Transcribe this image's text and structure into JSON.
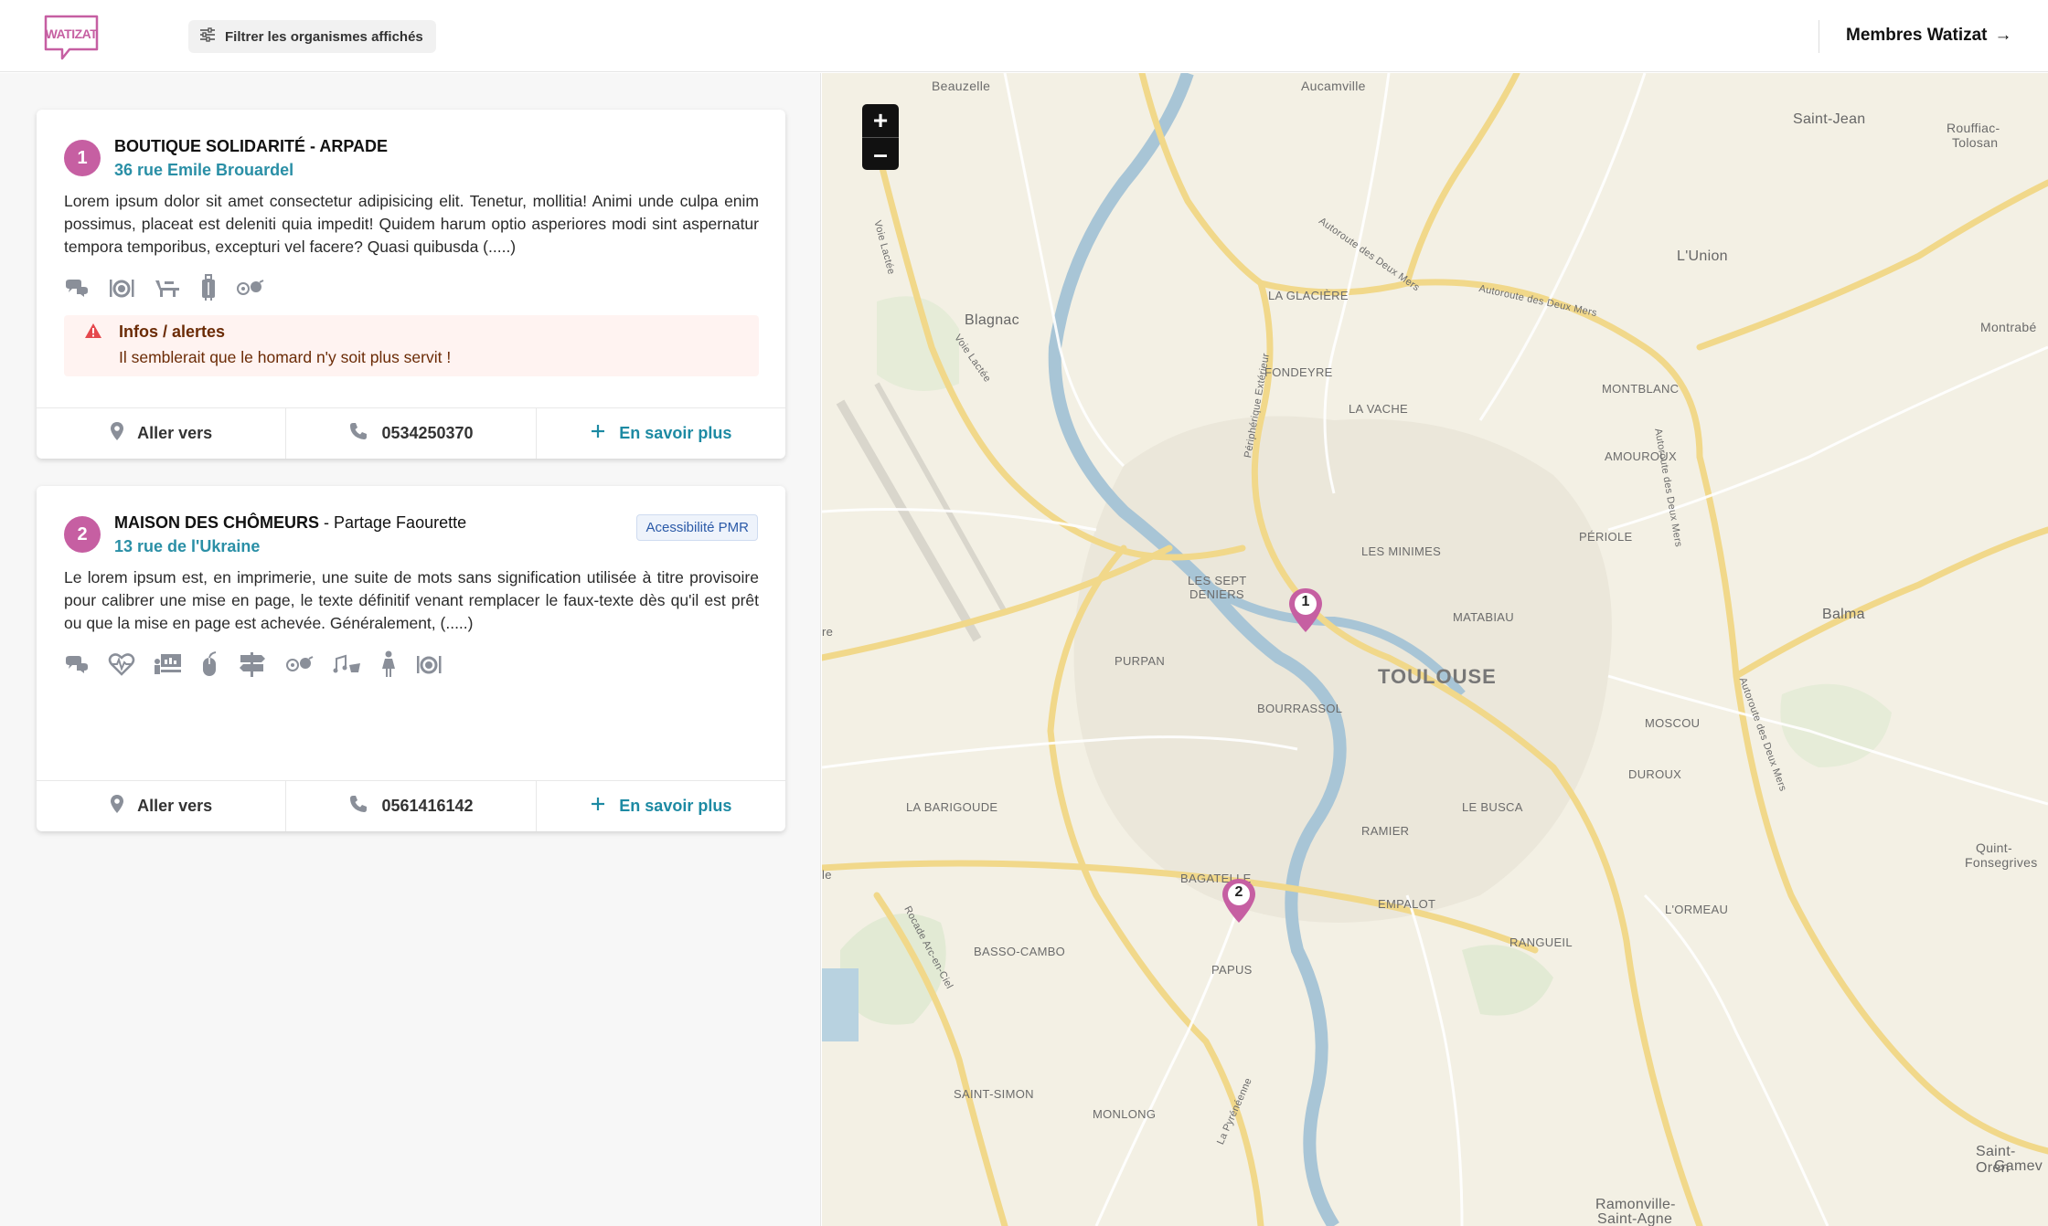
{
  "header": {
    "logo_text": "WATIZAT",
    "filter_label": "Filtrer les organismes affichés",
    "members_label": "Membres Watizat",
    "members_arrow": "→"
  },
  "cards": [
    {
      "number": "1",
      "title_bold": "BOUTIQUE SOLIDARITÉ - ARPADE",
      "title_rest": "",
      "address": "36 rue Emile Brouardel",
      "description": "Lorem ipsum dolor sit amet consectetur adipisicing elit. Tenetur, mollitia! Animi unde culpa enim possimus, placeat est deleniti quia impedit! Quidem harum optio asperiores modi sint aspernatur tempora temporibus, excepturi vel facere? Quasi quibusda (.....)",
      "icons": [
        "speech-bubbles-icon",
        "food-icon",
        "shower-icon",
        "luggage-icon",
        "games-icon"
      ],
      "alert": {
        "title": "Infos / alertes",
        "text": "Il semblerait que le homard n'y soit plus servit !"
      },
      "actions": {
        "directions": "Aller vers",
        "phone": "0534250370",
        "more": "En savoir plus"
      }
    },
    {
      "number": "2",
      "title_bold": "MAISON DES CHÔMEURS",
      "title_rest": " - Partage Faourette",
      "address": "13 rue de l'Ukraine",
      "badge": "Acessibilité PMR",
      "description": "Le lorem ipsum est, en imprimerie, une suite de mots sans signification utilisée à titre provisoire pour calibrer une mise en page, le texte définitif venant remplacer le faux-texte dès qu'il est prêt ou que la mise en page est achevée. Généralement, (.....)",
      "icons": [
        "speech-bubbles-icon",
        "health-icon",
        "training-icon",
        "computer-mouse-icon",
        "signpost-icon",
        "games-icon",
        "music-icon",
        "woman-icon",
        "food-icon"
      ],
      "actions": {
        "directions": "Aller vers",
        "phone": "0561416142",
        "more": "En savoir plus"
      }
    }
  ],
  "map": {
    "zoom_in": "+",
    "zoom_out": "–",
    "markers": [
      {
        "label": "1"
      },
      {
        "label": "2"
      }
    ],
    "labels": {
      "beauzelle": "Beauzelle",
      "aucamville": "Aucamville",
      "saint_jean": "Saint-Jean",
      "rouffiac": "Rouffiac-",
      "rouffiac2": "Tolosan",
      "lunion": "L'Union",
      "blagnac": "Blagnac",
      "montrabe": "Montrabé",
      "la_glaciere": "LA GLACIÈRE",
      "fondeyre": "FONDEYRE",
      "montblanc": "MONTBLANC",
      "la_vache": "LA VACHE",
      "amouroux": "AMOUROUX",
      "periole": "PÉRIOLE",
      "les_minimes": "LES MINIMES",
      "les_sept_deniers": "LES SEPT",
      "les_sept_deniers2": "DENIERS",
      "matabiau": "MATABIAU",
      "balma": "Balma",
      "purpan": "PURPAN",
      "toulouse": "TOULOUSE",
      "bourrassol": "BOURRASSOL",
      "moscou": "MOSCOU",
      "duroux": "DUROUX",
      "la_barigoude": "LA BARIGOUDE",
      "ramier": "RAMIER",
      "le_busca": "LE BUSCA",
      "bagatelle": "BAGATELLE",
      "empalot": "EMPALOT",
      "lormeau": "L'ORMEAU",
      "quint": "Quint-",
      "quint2": "Fonsegrives",
      "basso_cambo": "BASSO-CAMBO",
      "papus": "PAPUS",
      "rangueil": "RANGUEIL",
      "saint_simon": "SAINT-SIMON",
      "monlong": "MONLONG",
      "saint_orens": "Saint-Oren",
      "saint_orens2": "Gamev",
      "ramonville": "Ramonville-",
      "ramonville2": "Saint-Agne",
      "voie_lactee": "Voie Lactée",
      "autoroute_deux_mers": "Autoroute des Deux Mers",
      "peripherique": "Périphérique Extérieur",
      "rocade_arc_en_ciel": "Rocade Arc-en-Ciel",
      "la_pyreneenne": "La Pyrénéenne",
      "re": "re",
      "le": "le"
    }
  }
}
